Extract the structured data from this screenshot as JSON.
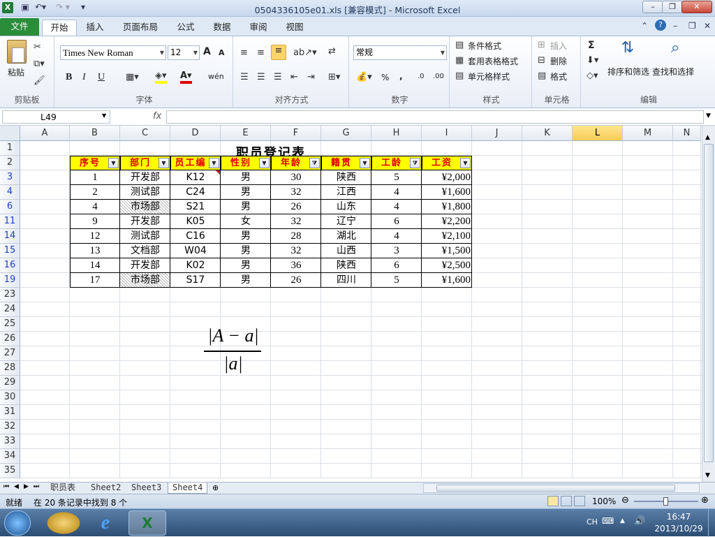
{
  "window": {
    "title": "0504336105e01.xls  [兼容模式] - Microsoft Excel",
    "minimize": "–",
    "restore": "❐",
    "close": "✕"
  },
  "tabs": [
    "文件",
    "开始",
    "插入",
    "页面布局",
    "公式",
    "数据",
    "审阅",
    "视图"
  ],
  "ribbon": {
    "clipboard": {
      "paste": "粘贴",
      "label": "剪贴板"
    },
    "font": {
      "name": "Times New Roman",
      "size": "12",
      "grow": "A",
      "shrink": "A",
      "bold": "B",
      "italic": "I",
      "underline": "U",
      "label": "字体",
      "wen": "wén"
    },
    "align": {
      "label": "对齐方式"
    },
    "number": {
      "format": "常规",
      "percent": "%",
      "comma": ",",
      "inc": ".0",
      "dec": ".00",
      "label": "数字"
    },
    "styles": {
      "conditional": "条件格式",
      "table": "套用表格格式",
      "cell": "单元格样式",
      "label": "样式"
    },
    "cells": {
      "insert": "插入",
      "delete": "删除",
      "format": "格式",
      "label": "单元格"
    },
    "editing": {
      "sort": "排序和筛选",
      "find": "查找和选择",
      "label": "编辑",
      "sum": "Σ"
    }
  },
  "namebox": "L49",
  "fx": "fx",
  "columns": [
    "A",
    "B",
    "C",
    "D",
    "E",
    "F",
    "G",
    "H",
    "I",
    "J",
    "K",
    "L",
    "M",
    "N"
  ],
  "rows": [
    "1",
    "2",
    "3",
    "4",
    "6",
    "11",
    "14",
    "15",
    "16",
    "19",
    "23",
    "24",
    "25",
    "26",
    "27",
    "28",
    "29",
    "30",
    "31",
    "32",
    "33",
    "34",
    "35"
  ],
  "table": {
    "title": "职员登记表",
    "headers": [
      "序号",
      "部门",
      "员工编",
      "性别",
      "年龄",
      "籍贯",
      "工龄",
      "工资"
    ],
    "rows": [
      [
        "1",
        "开发部",
        "K12",
        "男",
        "30",
        "陕西",
        "5",
        "¥2,000"
      ],
      [
        "2",
        "测试部",
        "C24",
        "男",
        "32",
        "江西",
        "4",
        "¥1,600"
      ],
      [
        "4",
        "市场部",
        "S21",
        "男",
        "26",
        "山东",
        "4",
        "¥1,800"
      ],
      [
        "9",
        "开发部",
        "K05",
        "女",
        "32",
        "辽宁",
        "6",
        "¥2,200"
      ],
      [
        "12",
        "测试部",
        "C16",
        "男",
        "28",
        "湖北",
        "4",
        "¥2,100"
      ],
      [
        "13",
        "文档部",
        "W04",
        "男",
        "32",
        "山西",
        "3",
        "¥1,500"
      ],
      [
        "14",
        "开发部",
        "K02",
        "男",
        "36",
        "陕西",
        "6",
        "¥2,500"
      ],
      [
        "17",
        "市场部",
        "S17",
        "男",
        "26",
        "四川",
        "5",
        "¥1,600"
      ]
    ]
  },
  "formula": {
    "numerator": "|A − a|",
    "denominator": "|a|"
  },
  "sheets": [
    "职员表",
    "Sheet2",
    "Sheet3",
    "Sheet4"
  ],
  "status": {
    "ready": "就绪",
    "message": "在 20 条记录中找到 8 个",
    "zoom": "100%"
  },
  "taskbar": {
    "lang": "CH",
    "time": "16:47",
    "date": "2013/10/29"
  }
}
